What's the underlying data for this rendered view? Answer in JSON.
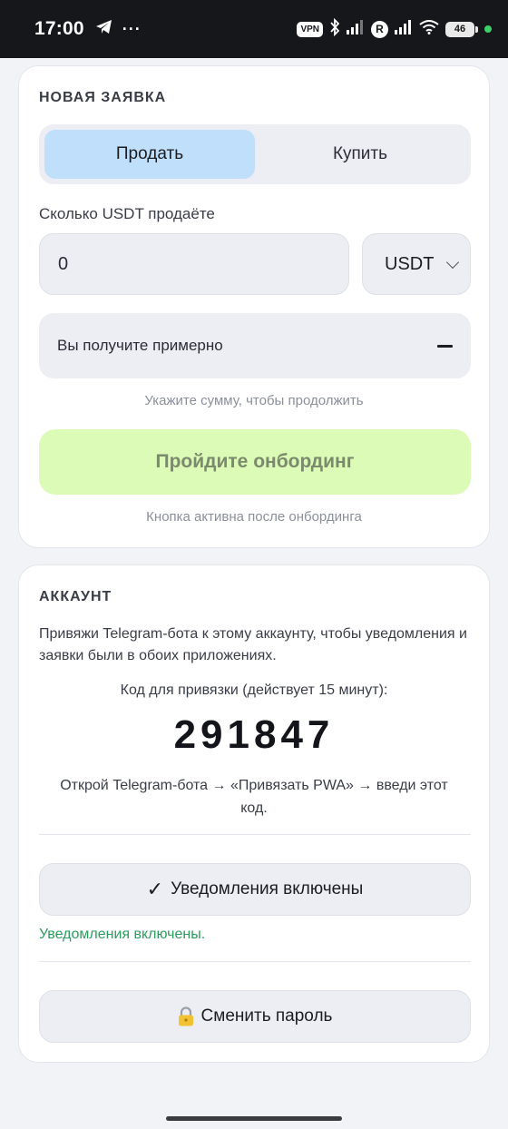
{
  "status_bar": {
    "time": "17:00",
    "more": "···",
    "vpn": "VPN",
    "r_badge": "R",
    "battery": "46",
    "icons": [
      "telegram-icon",
      "bluetooth-icon",
      "signal-icon",
      "wifi-icon",
      "battery-icon"
    ]
  },
  "order": {
    "title": "НОВАЯ ЗАЯВКА",
    "tabs": [
      {
        "label": "Продать",
        "active": true
      },
      {
        "label": "Купить",
        "active": false
      }
    ],
    "amount_label": "Сколько USDT продаёте",
    "amount_value": "0",
    "currency": "USDT",
    "receive_label": "Вы получите примерно",
    "receive_value": "—",
    "hint": "Укажите сумму, чтобы продолжить",
    "cta_label": "Пройдите онбординг",
    "cta_hint": "Кнопка активна после онбординга"
  },
  "account": {
    "title": "АККАУНТ",
    "description": "Привяжи Telegram-бота к этому аккаунту, чтобы уведомления и заявки были в обоих приложениях.",
    "code_label": "Код для привязки (действует 15 минут):",
    "code": "291847",
    "instruction": "Открой Telegram-бота → «Привязать PWA» → введи этот код.",
    "notifications_button": "Уведомления включены",
    "notifications_status": "Уведомления включены.",
    "change_password_button": "Сменить пароль"
  },
  "colors": {
    "active_tab": "#bfdffb",
    "cta_bg": "#dcfbb6",
    "success": "#2a9d5c"
  }
}
